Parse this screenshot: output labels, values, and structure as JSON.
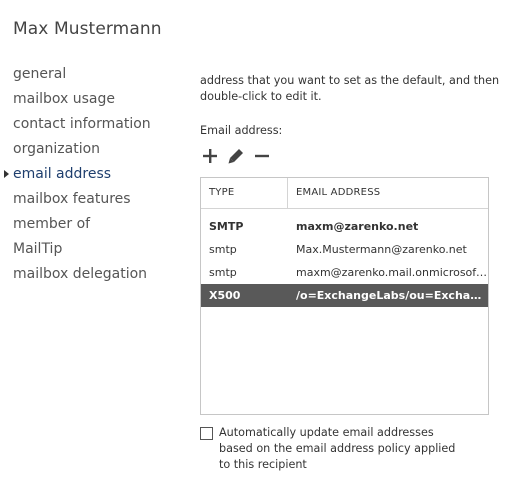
{
  "header": {
    "title": "Max Mustermann"
  },
  "nav": {
    "items": [
      {
        "label": "general"
      },
      {
        "label": "mailbox usage"
      },
      {
        "label": "contact information"
      },
      {
        "label": "organization"
      },
      {
        "label": "email address",
        "active": true
      },
      {
        "label": "mailbox features"
      },
      {
        "label": "member of"
      },
      {
        "label": "MailTip"
      },
      {
        "label": "mailbox delegation"
      }
    ]
  },
  "content": {
    "description": "address that you want to set as the default, and then double-click to edit it.",
    "field_label": "Email address:",
    "toolbar": {
      "add_icon": "plus-icon",
      "edit_icon": "pencil-icon",
      "remove_icon": "minus-icon"
    },
    "table": {
      "columns": [
        "TYPE",
        "EMAIL ADDRESS"
      ],
      "rows": [
        {
          "type": "SMTP",
          "email": "maxm@zarenko.net"
        },
        {
          "type": "smtp",
          "email": "Max.Mustermann@zarenko.net"
        },
        {
          "type": "smtp",
          "email": "maxm@zarenko.mail.onmicrosoft..."
        },
        {
          "type": "X500",
          "email": "/o=ExchangeLabs/ou=Exchange ..."
        }
      ]
    },
    "auto_update": {
      "label": "Automatically update email addresses based on the email address policy applied to this recipient",
      "checked": false
    }
  },
  "colors": {
    "active_nav": "#1f3f6e",
    "selected_row": "#595959"
  }
}
